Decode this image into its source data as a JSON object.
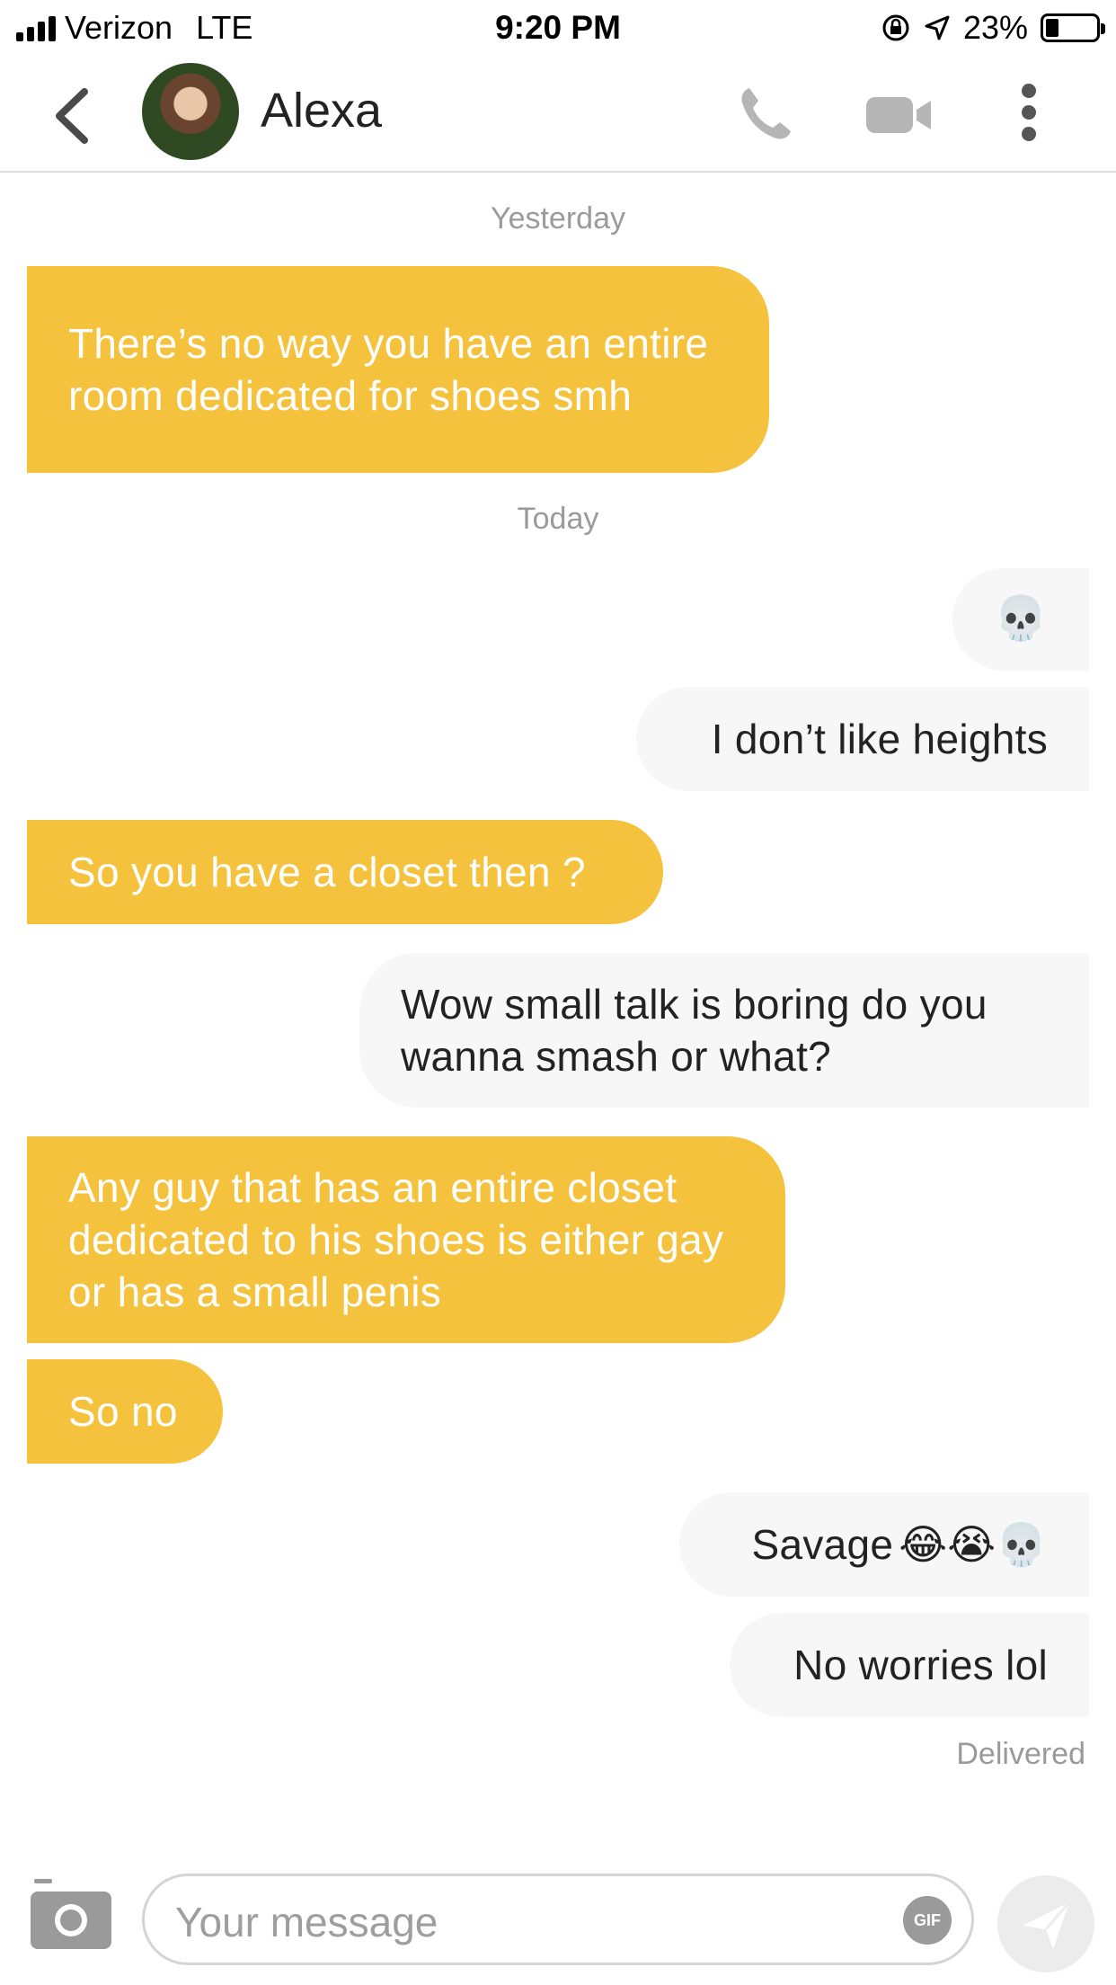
{
  "status_bar": {
    "carrier": "Verizon",
    "network": "LTE",
    "time": "9:20 PM",
    "battery": "23%"
  },
  "header": {
    "contact_name": "Alexa"
  },
  "chat": {
    "date_yesterday": "Yesterday",
    "date_today": "Today",
    "messages": [
      {
        "side": "in",
        "text": "There’s no way you have an entire room dedicated for shoes smh"
      },
      {
        "side": "out",
        "text": "💀"
      },
      {
        "side": "out",
        "text": "I don’t like heights"
      },
      {
        "side": "in",
        "text": "So you have a closet then ?"
      },
      {
        "side": "out",
        "text": "Wow small talk is boring do you wanna smash or what?"
      },
      {
        "side": "in",
        "text": "Any guy that has an entire closet dedicated to his shoes is either gay or has a small penis"
      },
      {
        "side": "in",
        "text": "So no"
      },
      {
        "side": "out",
        "text": "Savage",
        "emoji": "😂😭💀"
      },
      {
        "side": "out",
        "text": "No worries lol"
      }
    ],
    "status": "Delivered"
  },
  "composer": {
    "placeholder": "Your message",
    "gif_label": "GIF"
  },
  "colors": {
    "incoming_bubble": "#f5c23d",
    "outgoing_bubble": "#f7f7f7",
    "icon_grey": "#b0b0b0"
  },
  "icons": [
    "back-chevron-icon",
    "phone-icon",
    "video-camera-icon",
    "more-vertical-icon",
    "camera-icon",
    "gif-icon",
    "send-icon",
    "skull-emoji-icon",
    "tears-of-joy-emoji-icon",
    "crying-emoji-icon"
  ]
}
